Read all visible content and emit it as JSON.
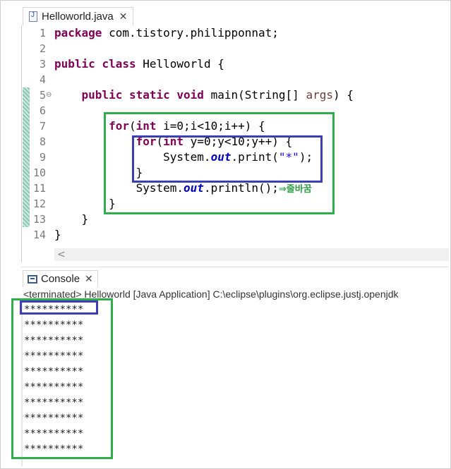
{
  "editor": {
    "tab_label": "Helloworld.java",
    "close_glyph": "✕",
    "fold_glyph": "⊖",
    "lines": [
      {
        "n": "1",
        "segs": [
          {
            "t": "package",
            "c": "kw"
          },
          {
            "t": " com.tistory.philipponnat;",
            "c": ""
          }
        ]
      },
      {
        "n": "2",
        "segs": []
      },
      {
        "n": "3",
        "segs": [
          {
            "t": "public",
            "c": "kw"
          },
          {
            "t": " ",
            "c": ""
          },
          {
            "t": "class",
            "c": "kw"
          },
          {
            "t": " Helloworld {",
            "c": ""
          }
        ]
      },
      {
        "n": "4",
        "segs": []
      },
      {
        "n": "5",
        "segs": [
          {
            "t": "    ",
            "c": ""
          },
          {
            "t": "public",
            "c": "kw"
          },
          {
            "t": " ",
            "c": ""
          },
          {
            "t": "static",
            "c": "kw"
          },
          {
            "t": " ",
            "c": ""
          },
          {
            "t": "void",
            "c": "kw"
          },
          {
            "t": " main(String[] ",
            "c": ""
          },
          {
            "t": "args",
            "c": "param"
          },
          {
            "t": ") {",
            "c": ""
          }
        ]
      },
      {
        "n": "6",
        "segs": []
      },
      {
        "n": "7",
        "segs": [
          {
            "t": "        ",
            "c": ""
          },
          {
            "t": "for",
            "c": "kw"
          },
          {
            "t": "(",
            "c": ""
          },
          {
            "t": "int",
            "c": "kw"
          },
          {
            "t": " i=0;i<10;i++) {",
            "c": ""
          }
        ]
      },
      {
        "n": "8",
        "segs": [
          {
            "t": "            ",
            "c": ""
          },
          {
            "t": "for",
            "c": "kw"
          },
          {
            "t": "(",
            "c": ""
          },
          {
            "t": "int",
            "c": "kw"
          },
          {
            "t": " y=0;y<10;y++) {",
            "c": ""
          }
        ]
      },
      {
        "n": "9",
        "segs": [
          {
            "t": "                System.",
            "c": ""
          },
          {
            "t": "out",
            "c": "fld"
          },
          {
            "t": ".print(",
            "c": ""
          },
          {
            "t": "\"*\"",
            "c": "str"
          },
          {
            "t": ");",
            "c": ""
          }
        ]
      },
      {
        "n": "10",
        "segs": [
          {
            "t": "            }",
            "c": ""
          }
        ]
      },
      {
        "n": "11",
        "segs": [
          {
            "t": "            System.",
            "c": ""
          },
          {
            "t": "out",
            "c": "fld"
          },
          {
            "t": ".println();",
            "c": ""
          },
          {
            "t": "⇒줄바꿈",
            "c": "comment"
          }
        ]
      },
      {
        "n": "12",
        "segs": [
          {
            "t": "        }",
            "c": ""
          }
        ]
      },
      {
        "n": "13",
        "segs": [
          {
            "t": "    }",
            "c": ""
          }
        ]
      },
      {
        "n": "14",
        "segs": [
          {
            "t": "}",
            "c": ""
          }
        ]
      }
    ],
    "hscroll_glyph": "<"
  },
  "console": {
    "tab_label": "Console",
    "close_glyph": "✕",
    "status": "<terminated> Helloworld [Java Application] C:\\eclipse\\plugins\\org.eclipse.justj.openjdk",
    "output": [
      "**********",
      "**********",
      "**********",
      "**********",
      "**********",
      "**********",
      "**********",
      "**********",
      "**********",
      "**********"
    ]
  },
  "colors": {
    "keyword": "#7f0055",
    "field": "#0000c0",
    "string": "#2a00ff",
    "annotation_green": "#2fae4b",
    "annotation_blue": "#3a3fb8"
  }
}
